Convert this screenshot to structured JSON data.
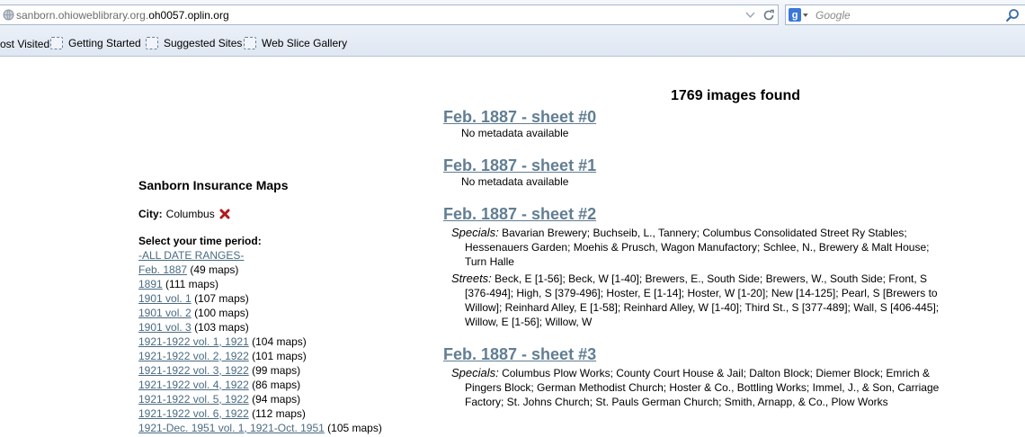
{
  "browser": {
    "url_prefix": "sanborn.ohioweblibrary.org.",
    "url_host": "oh0057.oplin.org",
    "search_placeholder": "Google",
    "bookmarks": [
      "ost Visited",
      "Getting Started",
      "Suggested Sites",
      "Web Slice Gallery"
    ]
  },
  "page": {
    "results_count": "1769 images found",
    "sidebar": {
      "heading": "Sanborn Insurance Maps",
      "city_label": "City:",
      "city_value": "Columbus",
      "period_label": "Select your time period:",
      "ranges": [
        {
          "label": "-ALL DATE RANGES-",
          "count": ""
        },
        {
          "label": "Feb. 1887",
          "count": "(49 maps)"
        },
        {
          "label": "1891",
          "count": "(111 maps)"
        },
        {
          "label": "1901 vol. 1",
          "count": "(107 maps)"
        },
        {
          "label": "1901 vol. 2",
          "count": "(100 maps)"
        },
        {
          "label": "1901 vol. 3",
          "count": "(103 maps)"
        },
        {
          "label": "1921-1922 vol. 1, 1921",
          "count": "(104 maps)"
        },
        {
          "label": "1921-1922 vol. 2, 1922",
          "count": "(101 maps)"
        },
        {
          "label": "1921-1922 vol. 3, 1922",
          "count": "(99 maps)"
        },
        {
          "label": "1921-1922 vol. 4, 1922",
          "count": "(86 maps)"
        },
        {
          "label": "1921-1922 vol. 5, 1922",
          "count": "(94 maps)"
        },
        {
          "label": "1921-1922 vol. 6, 1922",
          "count": "(112 maps)"
        },
        {
          "label": "1921-Dec. 1951 vol. 1, 1921-Oct. 1951",
          "count": "(105 maps)"
        }
      ]
    },
    "sheets": [
      {
        "title": "Feb. 1887 - sheet #0",
        "no_meta": "No metadata available"
      },
      {
        "title": "Feb. 1887 - sheet #1",
        "no_meta": "No metadata available"
      },
      {
        "title": "Feb. 1887 - sheet #2",
        "specials_label": "Specials:",
        "specials": "Bavarian Brewery; Buchseib, L., Tannery; Columbus Consolidated Street Ry Stables; Hessenauers Garden; Moehis & Prusch, Wagon Manufactory; Schlee, N., Brewery & Malt House; Turn Halle",
        "streets_label": "Streets:",
        "streets": "Beck, E [1-56]; Beck, W [1-40]; Brewers, E., South Side; Brewers, W., South Side; Front, S [376-494]; High, S [379-496]; Hoster, E [1-14]; Hoster, W [1-20]; New [14-125]; Pearl, S [Brewers to Willow]; Reinhard Alley, E [1-58]; Reinhard Alley, W [1-40]; Third St., S [377-489]; Wall, S [406-445]; Willow, E [1-56]; Willow, W"
      },
      {
        "title": "Feb. 1887 - sheet #3",
        "specials_label": "Specials:",
        "specials": "Columbus Plow Works; County Court House & Jail; Dalton Block; Diemer Block; Emrich & Pingers Block; German Methodist Church; Hoster & Co., Bottling Works; Immel, J., & Son, Carriage Factory; St. Johns Church; St. Pauls German Church; Smith, Arnapp, & Co., Plow Works"
      }
    ]
  }
}
